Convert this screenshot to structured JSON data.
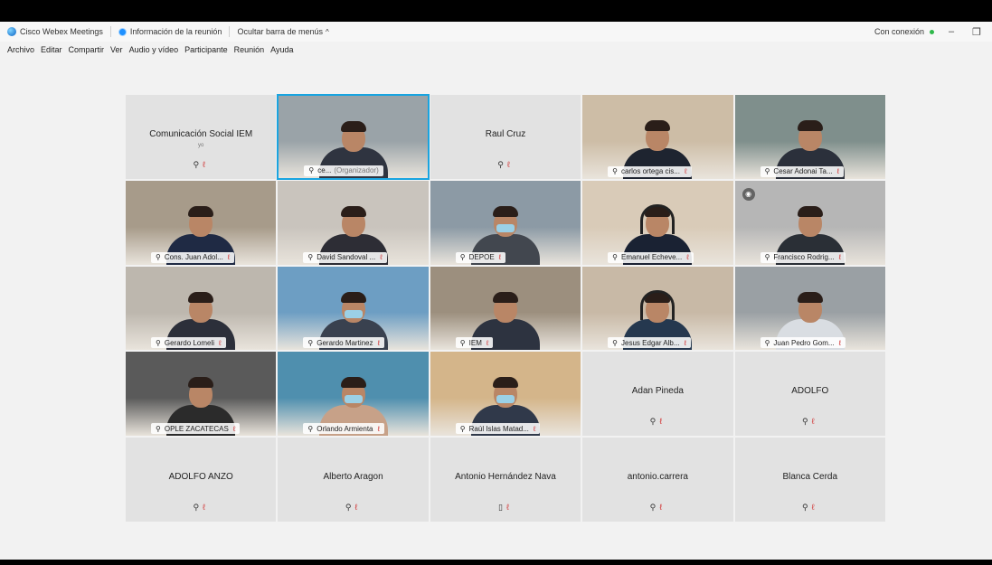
{
  "titlebar": {
    "app_name": "Cisco Webex Meetings",
    "meeting_info": "Información de la reunión",
    "hide_menu": "Ocultar barra de menús",
    "hide_menu_chevron": "^",
    "connection_status": "Con conexión",
    "minimize": "–",
    "restore": "❐"
  },
  "menu": [
    "Archivo",
    "Editar",
    "Compartir",
    "Ver",
    "Audio y vídeo",
    "Participante",
    "Reunión",
    "Ayuda"
  ],
  "icons": {
    "headset": "⚲",
    "mic_muted": "ℓ",
    "phone": "▯"
  },
  "colors": {
    "active_border": "#19a4e0",
    "muted_red": "#d23b3b",
    "connected_green": "#2fb84a"
  },
  "tiles": [
    {
      "name": "Comunicación Social IEM",
      "sub": "yo",
      "type": "text"
    },
    {
      "name": "ce...",
      "extra": "(Organizador)",
      "type": "video",
      "active": true
    },
    {
      "name": "Raul Cruz",
      "type": "text"
    },
    {
      "name": "carlos ortega cis...",
      "type": "video"
    },
    {
      "name": "Cesar Adonai Ta...",
      "type": "video"
    },
    {
      "name": "Cons. Juan Adol...",
      "type": "video"
    },
    {
      "name": "David Sandoval ...",
      "type": "video"
    },
    {
      "name": "DEPOE",
      "type": "video"
    },
    {
      "name": "Emanuel Echeve...",
      "type": "video"
    },
    {
      "name": "Francisco Rodrig...",
      "type": "video"
    },
    {
      "name": "Gerardo Lomeli",
      "type": "video"
    },
    {
      "name": "Gerardo Martinez",
      "type": "video"
    },
    {
      "name": "IEM",
      "type": "video"
    },
    {
      "name": "Jesus Edgar Alb...",
      "type": "video"
    },
    {
      "name": "Juan Pedro Gom...",
      "type": "video"
    },
    {
      "name": "OPLE ZACATECAS",
      "type": "video"
    },
    {
      "name": "Orlando Armienta",
      "type": "video"
    },
    {
      "name": "Raúl Islas Matad...",
      "type": "video"
    },
    {
      "name": "Adan Pineda",
      "type": "text"
    },
    {
      "name": "ADOLFO",
      "type": "text"
    },
    {
      "name": "ADOLFO ANZO",
      "type": "text"
    },
    {
      "name": "Alberto Aragon",
      "type": "text"
    },
    {
      "name": "Antonio Hernández Nava",
      "type": "text",
      "phone": true
    },
    {
      "name": "antonio.carrera",
      "type": "text"
    },
    {
      "name": "Blanca Cerda",
      "type": "text"
    }
  ]
}
